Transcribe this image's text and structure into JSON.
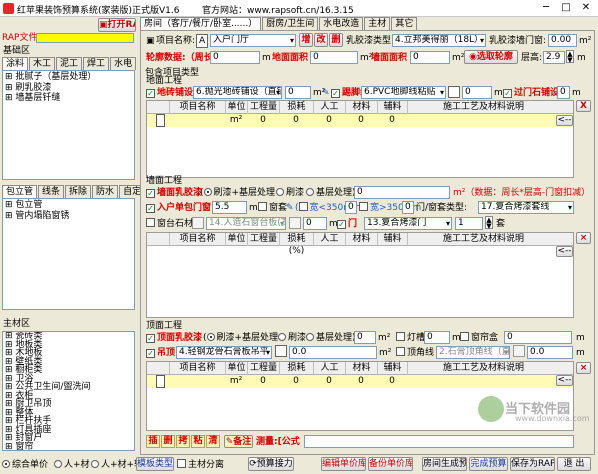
{
  "window": {
    "title": "红苹果装饰预算系统(家装版)正式版V1.6",
    "website": "官方网站：www.rapsoft.cn/16.3.15",
    "min": "─",
    "max": "□",
    "close": "✕"
  },
  "left": {
    "open_rap": "打开RAP",
    "rap_file_label": "RAP文件:",
    "base_area_title": "基础区",
    "tabs": [
      "涂料",
      "木工",
      "泥工",
      "焊工",
      "水电"
    ],
    "base_tree": [
      "批腻子（基层处理）",
      "刷乳胶漆",
      "墙基层钎缝"
    ],
    "lower_tabs": [
      "包立管",
      "线条",
      "拆除",
      "防水",
      "自定义"
    ],
    "lower_tree": [
      "包立管",
      "管内塌陷窗锈"
    ],
    "material_title": "主材区",
    "material_tree": [
      "瓷砖类",
      "地板类",
      "木地板",
      "壁纸类",
      "橱柜类",
      "卫浴",
      "公共卫生间/盥洗间",
      "衣柜",
      "厨卫吊顶",
      "整体",
      "栏杆扶手",
      "灯具插座",
      "封窗户",
      "窗帘"
    ]
  },
  "room_tabs": [
    "房间（客厅/餐厅/卧室......）",
    "厨房/卫生间",
    "水电改造",
    "主材",
    "其它"
  ],
  "project": {
    "name_label": "项目名称:",
    "name_value": "入户门厅",
    "btn_add": "增",
    "btn_modify": "改",
    "btn_delete": "删",
    "latex_type_label": "乳胶漆类型:",
    "latex_type_value": "4.立邦美得丽（18L）",
    "latex_area_label": "乳胶漆墙门窗:",
    "latex_area_value": "0.00",
    "unit_m2": "m²",
    "contour_label": "轮廓数据:（周长:",
    "contour_value": "0",
    "m_unit": "m",
    "floor_area_label": "地面面积",
    "floor_area_value": "0",
    "wall_area_label": "墙面面积",
    "wall_area_value": "0",
    "select_contour": "选取轮廓",
    "height_label": "层高:",
    "height_value": "2.9"
  },
  "section_include": "包含项目类型",
  "floor": {
    "title": "地面工程",
    "paving_label": "地砖铺设",
    "paving_value": "6.抛光地砖铺设（直铺",
    "area_value": "0",
    "baseboard_label": "踢脚线",
    "baseboard_value": "6.PVC地脚线粘贴",
    "baseboard_len": "0",
    "threshold_label": "过门石铺设",
    "threshold_value": "0"
  },
  "grid_headers": [
    "项目名称",
    "单位",
    "工程量",
    "损耗(%)",
    "人工",
    "材料",
    "辅料",
    "施工工艺及材料说明"
  ],
  "floor_row": {
    "unit": "m²",
    "qty": "0",
    "loss": "0",
    "labor": "0",
    "mat": "0",
    "aux": "0"
  },
  "wall": {
    "title": "墙面工程",
    "latex_label": "墙面乳胶漆",
    "base_opt": "刷漆+基层处理",
    "opt_paint": "刷漆",
    "opt_base": "基层处理",
    "latex_area": "0",
    "latex_unit_note": "m²（数据：周长*层高-门窗扣减）",
    "door_unit_label": "入户单包门窗",
    "door_unit_value": "5.5",
    "window_box_label": "窗套",
    "width_le_350": "宽<350mm",
    "width_gt_350": "宽>350mm",
    "width_value": "0",
    "door_type_label": "门/窗套类型:",
    "door_type_value": "17.复合烤漆套线",
    "sill_label": "窗台石材",
    "sill_value": "14.人造石窗台板(宽度<",
    "sill_len": "0",
    "door_label": "门",
    "door_value": "13.复合烤漆门",
    "door_count": "1",
    "door_count_unit": "套"
  },
  "ceiling": {
    "title": "顶面工程",
    "latex_label": "顶面乳胶漆",
    "base_opt": "刷漆+基层处理",
    "opt_paint": "刷漆",
    "opt_base": "基层处理",
    "latex_area": "0",
    "lamp_label": "灯槽",
    "lamp_value": "0",
    "curtain_box_label": "窗帘盒",
    "curtain_box_value": "0",
    "ceiling_label": "吊顶",
    "ceiling_value": "4.轻钢龙骨石膏板吊平",
    "ceiling_area": "0.0",
    "cornice_label": "顶角线",
    "cornice_value": "2.石膏顶角线（直线",
    "cornice_len": "0.0"
  },
  "ceiling_row": {
    "unit": "m²",
    "qty": "0",
    "loss": "0",
    "labor": "0",
    "mat": "0",
    "aux": "0"
  },
  "side_buttons": {
    "arrow": "<--",
    "x_close": "X",
    "x_mark": "×"
  },
  "edit_row": {
    "buttons": [
      "插",
      "删",
      "拷",
      "粘",
      "清"
    ],
    "note_btn": "备注",
    "measure_label": "测量:[公式"
  },
  "bottom": {
    "opt_combined": "综合单价",
    "opt_labor_mat": "人+材",
    "opt_labor_mat_aux": "人+材+辅",
    "template_type": "模板类型",
    "main_sep": "主材分离",
    "budget_engine": "预算接力",
    "edit_price": "编辑单价库",
    "backup_price": "备份单价库",
    "room_gen": "房间生成预算",
    "finish": "完成预算",
    "save_rap": "保存为RAP",
    "exit": "退 出"
  },
  "watermark": {
    "brand": "当下软件园",
    "url": "www.downxia.com"
  },
  "colors": {
    "red": "#d40000",
    "yellow": "#fffbb4",
    "title_bg": "#ffffff",
    "face": "#ece9d8"
  }
}
